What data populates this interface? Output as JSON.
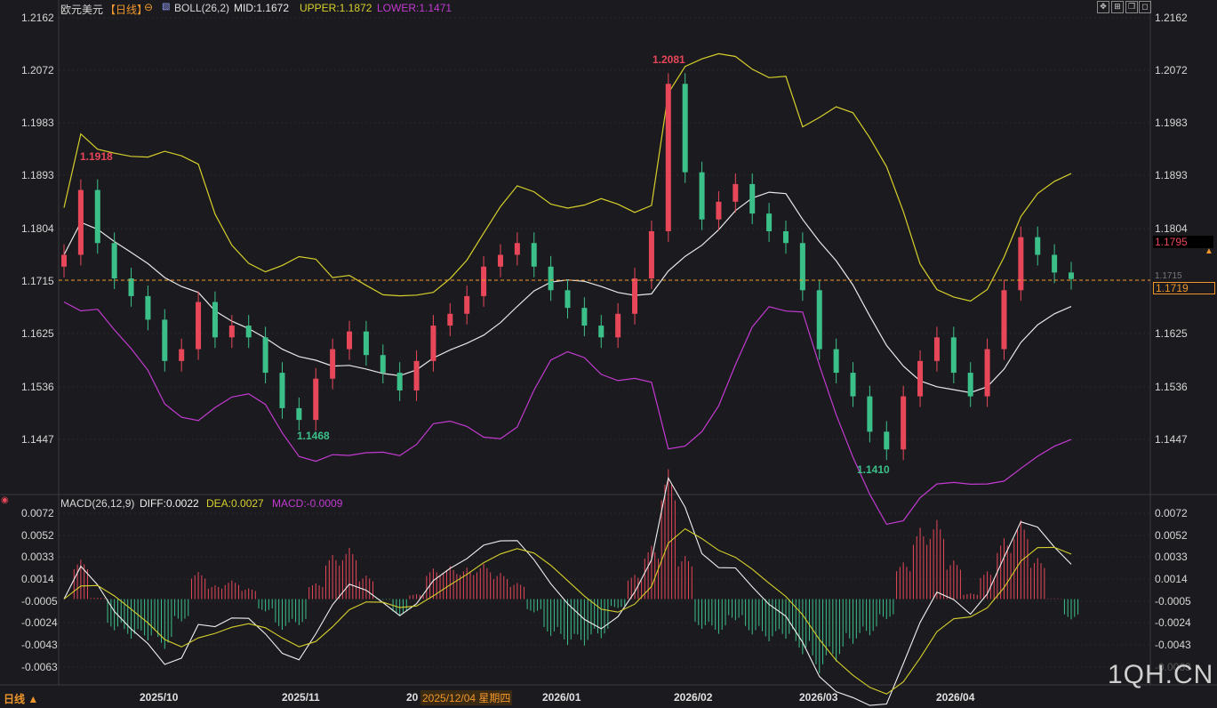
{
  "header": {
    "instrument": "欧元美元",
    "period": "【日线】",
    "boll_label": "BOLL(26,2)",
    "boll_mid": "MID:1.1672",
    "boll_upper": "UPPER:1.1872",
    "boll_lower": "LOWER:1.1471"
  },
  "macd_header": {
    "label": "MACD(26,12,9)",
    "diff": "DIFF:0.0022",
    "dea": "DEA:0.0027",
    "macd": "MACD:-0.0009"
  },
  "colors": {
    "up": "#e8475a",
    "down": "#3cc08a",
    "mid": "#e8e8e8",
    "upper": "#d6cf2c",
    "lower": "#c23ad0",
    "diff": "#f0f0f0",
    "dea": "#d6cf2c",
    "accent": "#f0962a"
  },
  "price_axis": [
    "1.2162",
    "1.2072",
    "1.1983",
    "1.1893",
    "1.1804",
    "1.1715",
    "1.1625",
    "1.1536",
    "1.1447"
  ],
  "macd_axis": [
    "0.0072",
    "0.0052",
    "0.0033",
    "0.0014",
    "-0.0005",
    "-0.0024",
    "-0.0043",
    "-0.0063"
  ],
  "macd_axis_right_partial": "-0.0063",
  "date_axis": [
    "2025/10",
    "2025/11",
    "20",
    "2026/01",
    "2026/02",
    "2026/03",
    "2026/04"
  ],
  "cursor_date": "2025/12/04 星期四",
  "period_button": "日线 ▲",
  "annotations": {
    "high_1": "1.1918",
    "high_2": "1.2081",
    "low_1": "1.1468",
    "low_2": "1.1410"
  },
  "price_tags": {
    "last": "1.1795",
    "crosshair": "1.1719",
    "hidden_axis_fragment": "1.1715"
  },
  "watermark": "1QH.CN",
  "toolbar_icons": [
    "move-icon",
    "zoom-icon",
    "restore-icon",
    "maximize-icon"
  ],
  "chart_data": {
    "type": "candlestick",
    "price_ylim": [
      1.1357,
      1.2162
    ],
    "macd_ylim": [
      -0.0072,
      0.0072
    ],
    "dates": [
      "2025/10",
      "2025/11",
      "2025/12",
      "2026/01",
      "2026/02",
      "2026/03",
      "2026/04"
    ],
    "series": [
      {
        "name": "EURUSD close (approx)",
        "values": [
          1.176,
          1.187,
          1.178,
          1.172,
          1.169,
          1.165,
          1.158,
          1.16,
          1.168,
          1.162,
          1.164,
          1.162,
          1.156,
          1.15,
          1.148,
          1.155,
          1.16,
          1.163,
          1.159,
          1.156,
          1.153,
          1.158,
          1.164,
          1.166,
          1.169,
          1.174,
          1.176,
          1.178,
          1.174,
          1.17,
          1.167,
          1.164,
          1.162,
          1.166,
          1.172,
          1.18,
          1.205,
          1.19,
          1.182,
          1.185,
          1.188,
          1.183,
          1.18,
          1.178,
          1.17,
          1.16,
          1.156,
          1.152,
          1.146,
          1.143,
          1.152,
          1.158,
          1.162,
          1.156,
          1.152,
          1.16,
          1.17,
          1.179,
          1.176,
          1.173,
          1.1719
        ]
      },
      {
        "name": "MID",
        "values": [
          1.1672
        ]
      },
      {
        "name": "UPPER",
        "values": [
          1.1872
        ]
      },
      {
        "name": "LOWER",
        "values": [
          1.1471
        ]
      }
    ]
  }
}
